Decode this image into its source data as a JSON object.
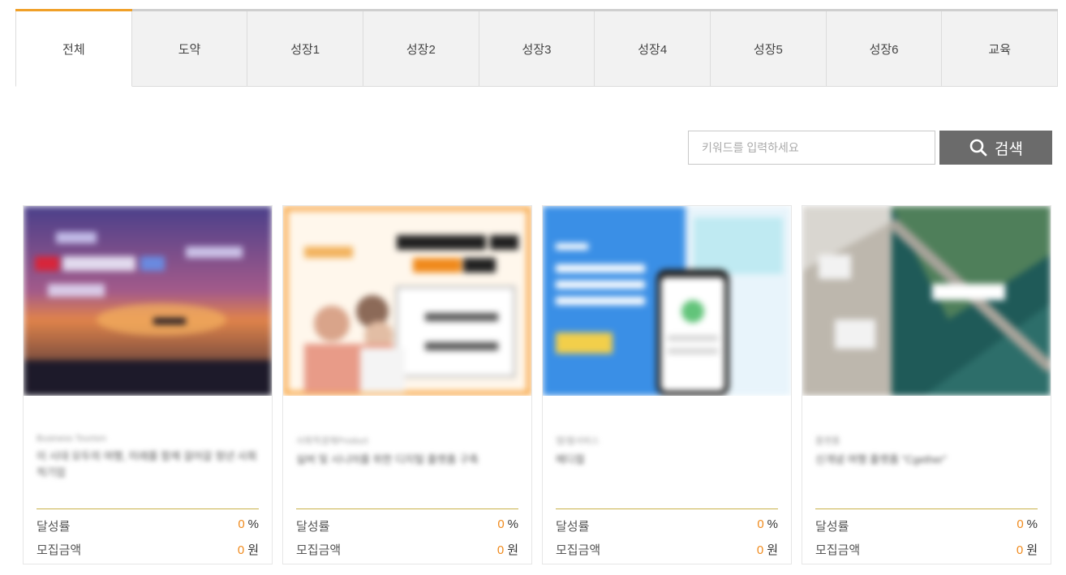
{
  "tabs": [
    "전체",
    "도약",
    "성장1",
    "성장2",
    "성장3",
    "성장4",
    "성장5",
    "성장6",
    "교육"
  ],
  "active_tab": "전체",
  "search": {
    "placeholder": "키워드를 입력하세요",
    "button_label": "검색"
  },
  "colors": {
    "accent": "#f0a028",
    "number": "#f08a1c",
    "search_button": "#6b6b6b"
  },
  "cards": [
    {
      "category": "Business Tourism",
      "title": "이 시대 모두의 여행, 미래를 함께 걸어갈 청년 사회적기업",
      "rate_label": "달성률",
      "rate_value": "0",
      "rate_unit": "%",
      "amount_label": "모집금액",
      "amount_value": "0",
      "amount_unit": "원"
    },
    {
      "category": "사회적경제Product",
      "title": "실버 및 시니어를 위한 디지털 플랫폼 구축",
      "rate_label": "달성률",
      "rate_value": "0",
      "rate_unit": "%",
      "amount_label": "모집금액",
      "amount_value": "0",
      "amount_unit": "원"
    },
    {
      "category": "앱/웹서비스",
      "title": "메디컬",
      "rate_label": "달성률",
      "rate_value": "0",
      "rate_unit": "%",
      "amount_label": "모집금액",
      "amount_value": "0",
      "amount_unit": "원"
    },
    {
      "category": "플랫폼",
      "title": "신개념 여행 플랫폼 \"Cgether\"",
      "rate_label": "달성률",
      "rate_value": "0",
      "rate_unit": "%",
      "amount_label": "모집금액",
      "amount_value": "0",
      "amount_unit": "원"
    }
  ]
}
